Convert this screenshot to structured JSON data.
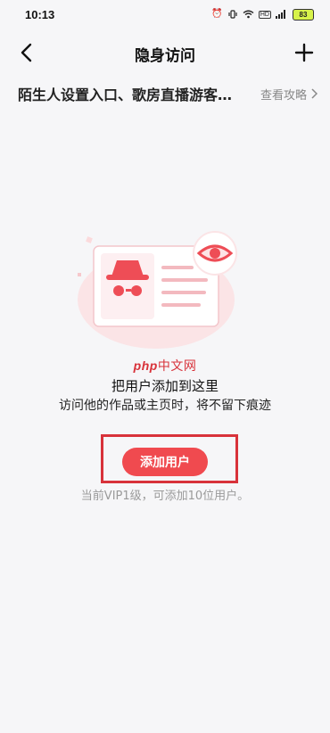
{
  "status_bar": {
    "time": "10:13",
    "hd": "HD",
    "battery": "83"
  },
  "nav": {
    "title": "隐身访问",
    "back_icon": "chevron-left-icon",
    "add_icon": "plus-icon"
  },
  "notice": {
    "text": "陌生人设置入口、歌房直播游客…",
    "link_label": "查看攻略"
  },
  "watermark": {
    "php": "php",
    "cn": "中文网"
  },
  "empty_state": {
    "title": "把用户添加到这里",
    "description": "访问他的作品或主页时，将不留下痕迹",
    "button_label": "添加用户",
    "quota_text": "当前VIP1级，可添加10位用户。"
  },
  "colors": {
    "accent": "#f04a4f",
    "highlight": "#d8323a",
    "background": "#f6f6f8"
  }
}
